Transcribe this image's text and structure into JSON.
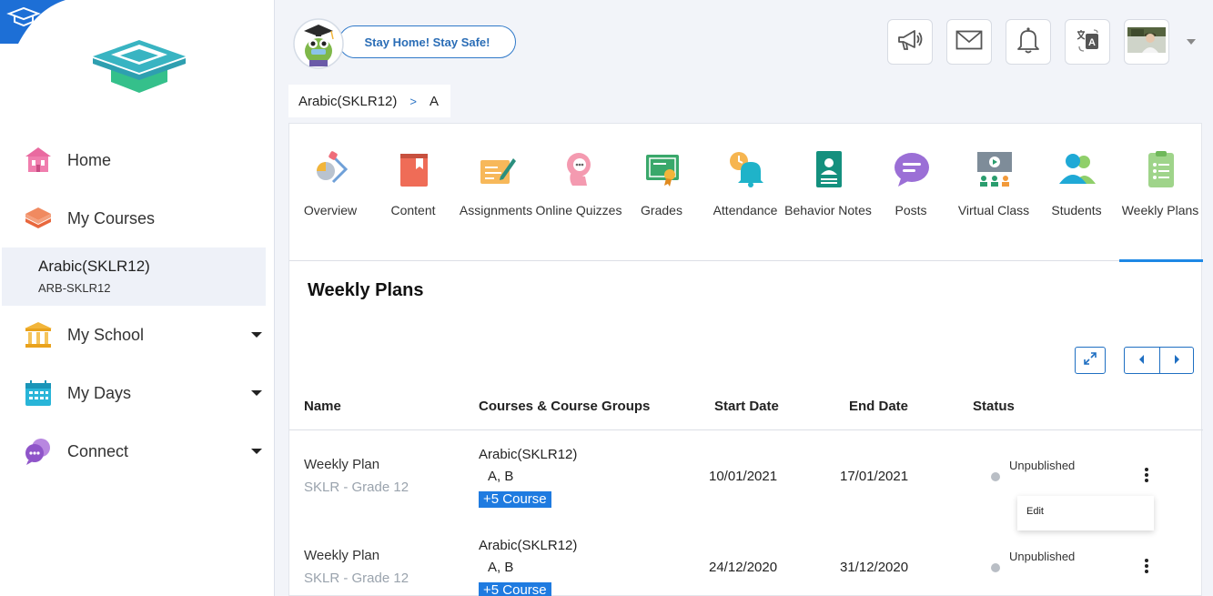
{
  "sidebar": {
    "nav": [
      {
        "label": "Home",
        "icon": "home-icon"
      },
      {
        "label": "My Courses",
        "icon": "courses-icon"
      },
      {
        "label": "My School",
        "icon": "school-icon"
      },
      {
        "label": "My Days",
        "icon": "calendar-icon"
      },
      {
        "label": "Connect",
        "icon": "connect-icon"
      }
    ],
    "current_course": {
      "name": "Arabic(SKLR12)",
      "code": "ARB-SKLR12"
    }
  },
  "header": {
    "banner": "Stay Home! Stay Safe!",
    "buttons": [
      "megaphone-icon",
      "mail-icon",
      "bell-icon",
      "translate-icon",
      "profile-avatar"
    ]
  },
  "breadcrumb": {
    "course": "Arabic(SKLR12)",
    "separator": ">",
    "group": "A"
  },
  "tabs": [
    {
      "label": "Overview",
      "icon": "overview-icon"
    },
    {
      "label": "Content",
      "icon": "content-book-icon"
    },
    {
      "label": "Assignments",
      "icon": "assignments-icon"
    },
    {
      "label": "Online Quizzes",
      "icon": "quiz-icon"
    },
    {
      "label": "Grades",
      "icon": "grades-certificate-icon"
    },
    {
      "label": "Attendance",
      "icon": "attendance-bell-icon"
    },
    {
      "label": "Behavior Notes",
      "icon": "behavior-notes-icon"
    },
    {
      "label": "Posts",
      "icon": "posts-chat-icon"
    },
    {
      "label": "Virtual Class",
      "icon": "virtual-class-icon"
    },
    {
      "label": "Students",
      "icon": "students-icon"
    },
    {
      "label": "Weekly Plans",
      "icon": "weekly-plans-icon"
    }
  ],
  "active_tab": "Weekly Plans",
  "section": {
    "title": "Weekly Plans"
  },
  "table": {
    "columns": [
      "Name",
      "Courses & Course Groups",
      "Start Date",
      "End Date",
      "Status"
    ],
    "rows": [
      {
        "name": "Weekly Plan",
        "sub": "SKLR - Grade 12",
        "course": "Arabic(SKLR12)",
        "groups": "A, B",
        "more": "+5 Course",
        "start": "10/01/2021",
        "end": "17/01/2021",
        "status": "Unpublished"
      },
      {
        "name": "Weekly Plan",
        "sub": "SKLR - Grade 12",
        "course": "Arabic(SKLR12)",
        "groups": "A, B",
        "more": "+5 Course",
        "start": "24/12/2020",
        "end": "31/12/2020",
        "status": "Unpublished"
      }
    ]
  },
  "row_menu": {
    "edit_label": "Edit"
  },
  "colors": {
    "accent": "#1e88e5",
    "badge": "#1f7be0",
    "status_unpublished": "#b9bec5"
  }
}
